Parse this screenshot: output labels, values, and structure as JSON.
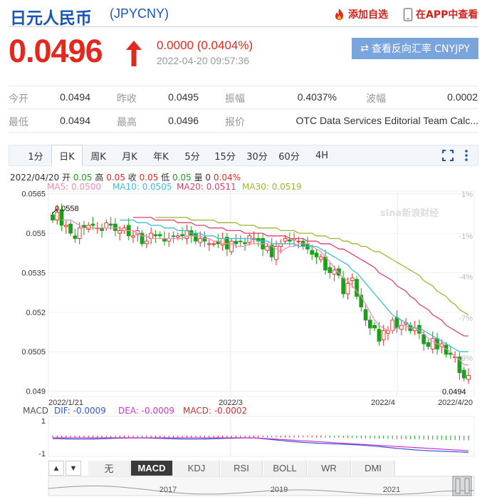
{
  "header": {
    "title": "日元人民币",
    "code": "(JPYCNY)",
    "add_watch": "添加自选",
    "app_view": "在APP中查看"
  },
  "quote": {
    "price": "0.0496",
    "change": "0.0000 (0.0404%)",
    "timestamp": "2022-04-20 09:57:36",
    "reverse_button": "查看反向汇率 CNYJPY",
    "rows": [
      [
        {
          "label": "今开",
          "value": "0.0494"
        },
        {
          "label": "昨收",
          "value": "0.0495"
        },
        {
          "label": "振幅",
          "value": "0.4037%"
        },
        {
          "label": "波幅",
          "value": "0.0002"
        }
      ],
      [
        {
          "label": "最低",
          "value": "0.0494"
        },
        {
          "label": "最高",
          "value": "0.0496"
        },
        {
          "label": "报价",
          "value": "OTC Data Services Editorial Team Calc..."
        }
      ]
    ]
  },
  "tabs": [
    "1分",
    "日K",
    "周K",
    "月K",
    "年K",
    "5分",
    "15分",
    "30分",
    "60分",
    "4H"
  ],
  "active_tab": "日K",
  "ohlc": {
    "date": "2022/04/20",
    "open_label": "开",
    "open": "0.05",
    "high_label": "高",
    "high": "0.05",
    "close_label": "收",
    "close": "0.05",
    "low_label": "低",
    "low": "0.05",
    "vol_label": "量",
    "vol": "0",
    "pct": "0.04%"
  },
  "ma": [
    {
      "label": "MA5: 0.0500",
      "color": "#f58bb4"
    },
    {
      "label": "MA10: 0.0505",
      "color": "#3dbcd6"
    },
    {
      "label": "MA20: 0.0511",
      "color": "#e0416b"
    },
    {
      "label": "MA30: 0.0519",
      "color": "#9eb52f"
    }
  ],
  "watermark": "sina新浪财经",
  "colors": {
    "up": "#e5281e",
    "down": "#1aa11a",
    "accent": "#1a55b5"
  },
  "chart_data": {
    "type": "candlestick",
    "ylim": [
      0.0488,
      0.0566
    ],
    "y_ticks": [
      "0.0565",
      "0.055",
      "0.0535",
      "0.052",
      "0.0505",
      "0.049"
    ],
    "y_tick_values": [
      0.0565,
      0.055,
      0.0535,
      0.052,
      0.0505,
      0.049
    ],
    "pct_ticks": [
      "1%",
      "-1%",
      "-4%",
      "-7%",
      "-9%"
    ],
    "x_ticks": [
      "2022/1/21",
      "2022/3",
      "2022/4",
      "2022/4/20"
    ],
    "high_label": "0.0558",
    "low_label": "0.0494",
    "closes": [
      0.0555,
      0.0558,
      0.0553,
      0.0553,
      0.055,
      0.0548,
      0.0552,
      0.0552,
      0.0553,
      0.0553,
      0.0552,
      0.0551,
      0.0554,
      0.0553,
      0.0551,
      0.0551,
      0.0552,
      0.0549,
      0.0549,
      0.0551,
      0.0546,
      0.0547,
      0.055,
      0.0549,
      0.0549,
      0.0547,
      0.0548,
      0.0549,
      0.0549,
      0.0549,
      0.0551,
      0.0549,
      0.0547,
      0.0548,
      0.0547,
      0.0546,
      0.0546,
      0.0546,
      0.0548,
      0.0544,
      0.0547,
      0.0546,
      0.0547,
      0.0546,
      0.0549,
      0.0548,
      0.0547,
      0.0544,
      0.0545,
      0.0541,
      0.0545,
      0.0546,
      0.0548,
      0.0547,
      0.0548,
      0.0547,
      0.0545,
      0.0544,
      0.0542,
      0.0541,
      0.0541,
      0.0536,
      0.0535,
      0.0536,
      0.0534,
      0.0527,
      0.0531,
      0.0533,
      0.0526,
      0.0522,
      0.0517,
      0.0514,
      0.0514,
      0.0509,
      0.0513,
      0.0513,
      0.0517,
      0.0514,
      0.0515,
      0.0516,
      0.0513,
      0.0514,
      0.0512,
      0.0508,
      0.0507,
      0.051,
      0.0506,
      0.0508,
      0.0504,
      0.0504,
      0.0503,
      0.0497,
      0.0495,
      0.0496
    ],
    "ma5": [
      0.0555,
      0.0555,
      0.0555,
      0.0554,
      0.0553,
      0.0552,
      0.0552,
      0.0552,
      0.0552,
      0.0552,
      0.0552,
      0.0552,
      0.0552,
      0.0552,
      0.0551,
      0.0551,
      0.0551,
      0.055,
      0.0549,
      0.0549,
      0.0548,
      0.0548,
      0.0548,
      0.0548,
      0.0548,
      0.0548,
      0.0548,
      0.0548,
      0.0549,
      0.0549,
      0.0549,
      0.0549,
      0.0548,
      0.0548,
      0.0547,
      0.0547,
      0.0546,
      0.0546,
      0.0546,
      0.0545,
      0.0545,
      0.0545,
      0.0546,
      0.0546,
      0.0546,
      0.0546,
      0.0546,
      0.0545,
      0.0544,
      0.0543,
      0.0544,
      0.0545,
      0.0545,
      0.0546,
      0.0546,
      0.0546,
      0.0545,
      0.0544,
      0.0543,
      0.0541,
      0.0539,
      0.0537,
      0.0535,
      0.0533,
      0.0532,
      0.053,
      0.0528,
      0.0526,
      0.0523,
      0.052,
      0.0517,
      0.0515,
      0.0514,
      0.0513,
      0.0513,
      0.0514,
      0.0515,
      0.0515,
      0.0514,
      0.0514,
      0.0513,
      0.0512,
      0.051,
      0.0509,
      0.0508,
      0.0507,
      0.0506,
      0.0505,
      0.0503,
      0.0502,
      0.05,
      0.05
    ],
    "ma10": [
      0.0555,
      0.0555,
      0.0555,
      0.0555,
      0.0554,
      0.0554,
      0.0554,
      0.0553,
      0.0553,
      0.0553,
      0.0552,
      0.0552,
      0.0552,
      0.0551,
      0.0551,
      0.0551,
      0.055,
      0.055,
      0.055,
      0.0549,
      0.0549,
      0.0549,
      0.0548,
      0.0548,
      0.0548,
      0.0548,
      0.0548,
      0.0548,
      0.0548,
      0.0548,
      0.0548,
      0.0547,
      0.0547,
      0.0547,
      0.0546,
      0.0546,
      0.0546,
      0.0546,
      0.0546,
      0.0546,
      0.0545,
      0.0545,
      0.0545,
      0.0545,
      0.0545,
      0.0544,
      0.0543,
      0.0542,
      0.0541,
      0.054,
      0.0539,
      0.0538,
      0.0536,
      0.0535,
      0.0533,
      0.0531,
      0.0529,
      0.0527,
      0.0525,
      0.0523,
      0.0521,
      0.0519,
      0.0518,
      0.0517,
      0.0516,
      0.0515,
      0.0514,
      0.0514,
      0.0513,
      0.0512,
      0.0511,
      0.051,
      0.0509,
      0.0508,
      0.0507,
      0.0506,
      0.0505,
      0.0505,
      0.0505
    ],
    "ma20": [
      0.0556,
      0.0556,
      0.0556,
      0.0556,
      0.0556,
      0.0555,
      0.0555,
      0.0555,
      0.0555,
      0.0555,
      0.0554,
      0.0554,
      0.0554,
      0.0554,
      0.0553,
      0.0553,
      0.0553,
      0.0552,
      0.0552,
      0.0552,
      0.0552,
      0.0551,
      0.0551,
      0.0551,
      0.0551,
      0.055,
      0.055,
      0.055,
      0.055,
      0.055,
      0.0549,
      0.0549,
      0.0549,
      0.0549,
      0.0549,
      0.0548,
      0.0548,
      0.0548,
      0.0548,
      0.0547,
      0.0547,
      0.0547,
      0.0546,
      0.0546,
      0.0546,
      0.0545,
      0.0544,
      0.0544,
      0.0543,
      0.0542,
      0.0541,
      0.054,
      0.0539,
      0.0538,
      0.0537,
      0.0535,
      0.0534,
      0.0533,
      0.0532,
      0.053,
      0.0529,
      0.0528,
      0.0526,
      0.0525,
      0.0523,
      0.0522,
      0.0521,
      0.0519,
      0.0518,
      0.0517,
      0.0515,
      0.0514,
      0.0513,
      0.0512,
      0.0511,
      0.0511
    ],
    "ma30": [
      0.0556,
      0.0556,
      0.0556,
      0.0556,
      0.0556,
      0.0556,
      0.0556,
      0.0556,
      0.0555,
      0.0555,
      0.0555,
      0.0555,
      0.0555,
      0.0555,
      0.0554,
      0.0554,
      0.0554,
      0.0554,
      0.0554,
      0.0553,
      0.0553,
      0.0553,
      0.0553,
      0.0552,
      0.0552,
      0.0552,
      0.0552,
      0.0552,
      0.0551,
      0.0551,
      0.0551,
      0.0551,
      0.055,
      0.055,
      0.055,
      0.055,
      0.0549,
      0.0549,
      0.0549,
      0.0548,
      0.0548,
      0.0548,
      0.0547,
      0.0547,
      0.0546,
      0.0546,
      0.0545,
      0.0545,
      0.0544,
      0.0543,
      0.0543,
      0.0542,
      0.0541,
      0.054,
      0.0539,
      0.0538,
      0.0537,
      0.0536,
      0.0535,
      0.0534,
      0.0532,
      0.0531,
      0.053,
      0.0528,
      0.0527,
      0.0526,
      0.0524,
      0.0523,
      0.0521,
      0.052,
      0.0519
    ]
  },
  "macd": {
    "label": "MACD",
    "dif_label": "DIF: -0.0009",
    "dea_label": "DEA: -0.0009",
    "macd_label": "MACD: -0.0002",
    "ticks": [
      "1",
      "-1"
    ],
    "dif_color": "#3355dd",
    "dea_color": "#cc33cc",
    "macd_color": "#cc3333"
  },
  "indicators": [
    "无",
    "MACD",
    "KDJ",
    "RSI",
    "BOLL",
    "WR",
    "DMI"
  ],
  "active_indicator": "MACD",
  "navigator_years": [
    "2017",
    "2019",
    "2021"
  ]
}
